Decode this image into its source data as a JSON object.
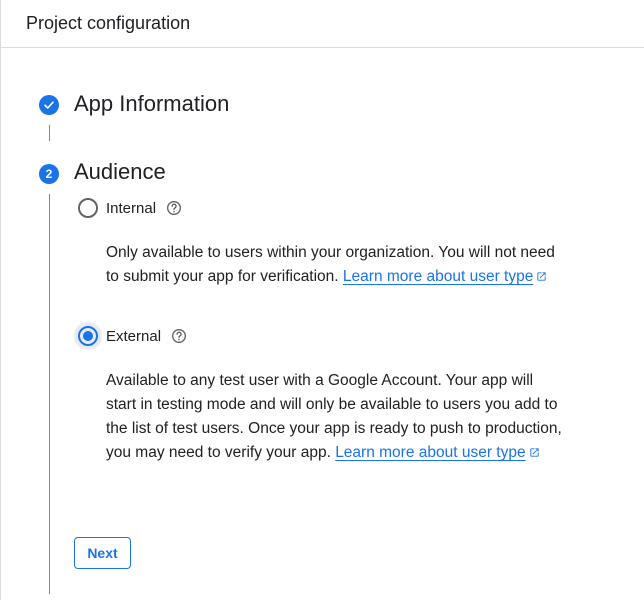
{
  "header": {
    "title": "Project configuration"
  },
  "steps": [
    {
      "number": "",
      "title": "App Information",
      "status": "completed",
      "icon": "check-icon"
    },
    {
      "number": "2",
      "title": "Audience",
      "status": "active"
    }
  ],
  "audience": {
    "options": [
      {
        "label": "Internal",
        "selected": false,
        "help_icon": "help-icon",
        "description": "Only available to users within your organization. You will not need to submit your app for verification.",
        "link_text": "Learn more about user type",
        "link_icon": "external-link-icon"
      },
      {
        "label": "External",
        "selected": true,
        "help_icon": "help-icon",
        "description": "Available to any test user with a Google Account. Your app will start in testing mode and will only be available to users you add to the list of test users. Once your app is ready to push to production, you may need to verify your app.",
        "link_text": "Learn more about user type",
        "link_icon": "external-link-icon"
      }
    ]
  },
  "actions": {
    "next_label": "Next"
  },
  "colors": {
    "accent": "#1a73e8",
    "text": "#202124",
    "border": "#dadce0",
    "focus_halo": "#e8eaf6"
  }
}
